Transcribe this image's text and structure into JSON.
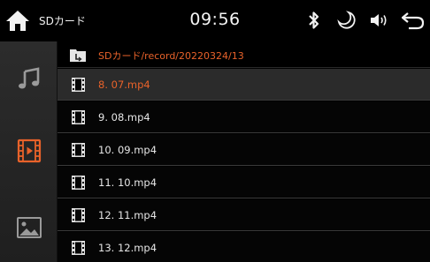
{
  "status_bar": {
    "source_label": "SDカード",
    "clock": "09:56",
    "icons": [
      "home-icon",
      "bluetooth-icon",
      "night-mode-icon",
      "volume-icon",
      "back-icon"
    ]
  },
  "sidebar": {
    "items": [
      {
        "name": "music",
        "icon": "music-note-icon",
        "active": false
      },
      {
        "name": "video",
        "icon": "film-icon",
        "active": true
      },
      {
        "name": "photo",
        "icon": "picture-icon",
        "active": false
      }
    ],
    "accent": "#e8622a"
  },
  "file_list": {
    "path": "SDカード/record/20220324/13",
    "files": [
      {
        "label": "8.  07.mp4",
        "selected": true
      },
      {
        "label": "9.  08.mp4",
        "selected": false
      },
      {
        "label": "10.  09.mp4",
        "selected": false
      },
      {
        "label": "11.  10.mp4",
        "selected": false
      },
      {
        "label": "12.  11.mp4",
        "selected": false
      },
      {
        "label": "13.  12.mp4",
        "selected": false
      }
    ]
  }
}
